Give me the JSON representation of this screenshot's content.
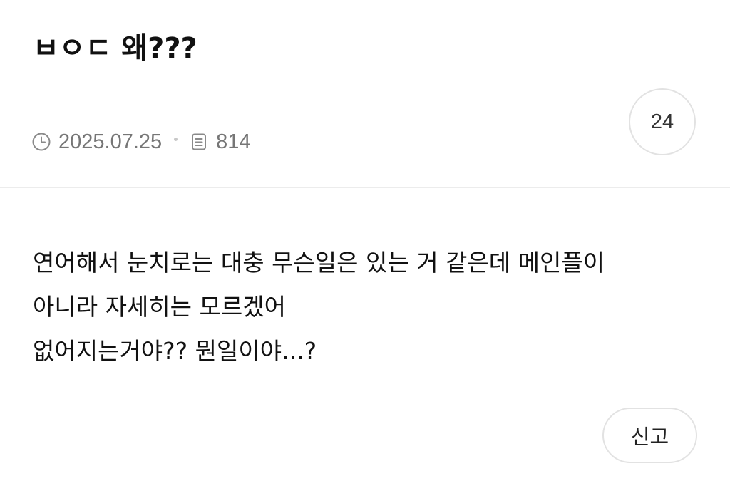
{
  "post": {
    "title": "ㅂㅇㄷ 왜???",
    "date": "2025.07.25",
    "views": "814",
    "comment_count": "24",
    "body_lines": [
      "연어해서 눈치로는 대충 무슨일은 있는 거 같은데 메인플이",
      "아니라 자세히는 모르겠어",
      "없어지는거야?? 뭔일이야...?"
    ]
  },
  "actions": {
    "report_label": "신고"
  },
  "icons": {
    "date": "clock-icon",
    "views": "document-icon"
  },
  "colors": {
    "meta_text": "#767676",
    "border": "#e2e2e2",
    "divider": "#ececec"
  }
}
